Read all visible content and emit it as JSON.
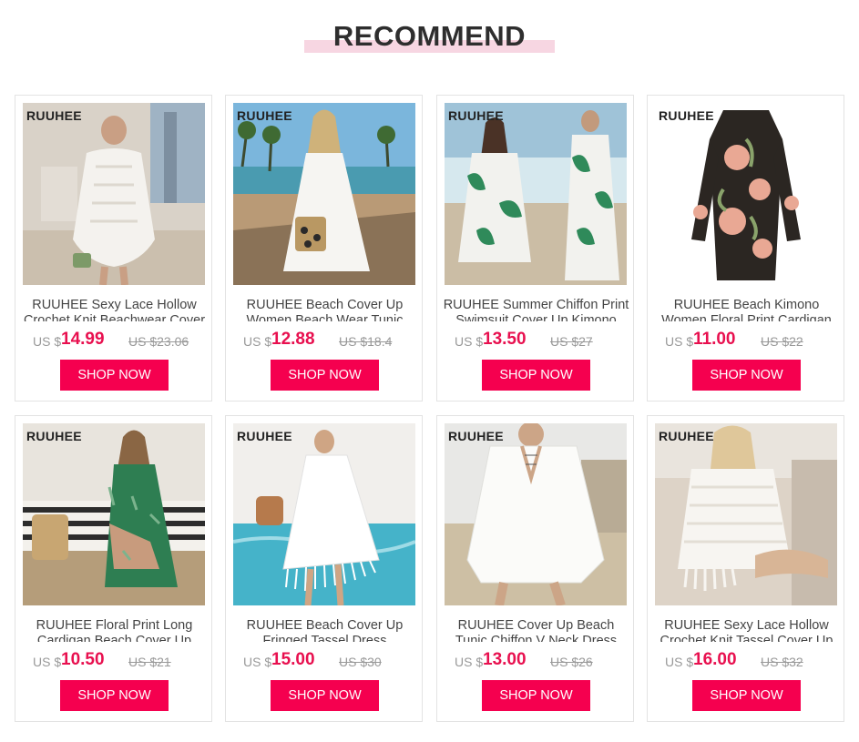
{
  "section": {
    "title": "RECOMMEND",
    "accent_color": "#f5004f",
    "title_underline_color": "#f7d6e2"
  },
  "products": [
    {
      "brand": "RUUHEE",
      "name": "RUUHEE Sexy Lace Hollow Crochet Knit Beachwear Cover Up",
      "currency": "US $",
      "price": "14.99",
      "old_price": "US $23.06",
      "button": "SHOP NOW"
    },
    {
      "brand": "RUUHEE",
      "name": "RUUHEE Beach Cover Up Women Beach Wear Tunic Dress",
      "currency": "US $",
      "price": "12.88",
      "old_price": "US $18.4",
      "button": "SHOP NOW"
    },
    {
      "brand": "RUUHEE",
      "name": "RUUHEE Summer Chiffon Print Swimsuit Cover Up Kimono",
      "currency": "US $",
      "price": "13.50",
      "old_price": "US $27",
      "button": "SHOP NOW"
    },
    {
      "brand": "RUUHEE",
      "name": "RUUHEE Beach Kimono Women Floral Print Cardigan",
      "currency": "US $",
      "price": "11.00",
      "old_price": "US $22",
      "button": "SHOP NOW"
    },
    {
      "brand": "RUUHEE",
      "name": "RUUHEE Floral Print Long Cardigan Beach Cover Up",
      "currency": "US $",
      "price": "10.50",
      "old_price": "US $21",
      "button": "SHOP NOW"
    },
    {
      "brand": "RUUHEE",
      "name": "RUUHEE Beach Cover Up Fringed Tassel Dress",
      "currency": "US $",
      "price": "15.00",
      "old_price": "US $30",
      "button": "SHOP NOW"
    },
    {
      "brand": "RUUHEE",
      "name": "RUUHEE Cover Up Beach Tunic Chiffon V Neck Dress",
      "currency": "US $",
      "price": "13.00",
      "old_price": "US $26",
      "button": "SHOP NOW"
    },
    {
      "brand": "RUUHEE",
      "name": "RUUHEE Sexy Lace Hollow Crochet Knit Tassel Cover Up",
      "currency": "US $",
      "price": "16.00",
      "old_price": "US $32",
      "button": "SHOP NOW"
    }
  ]
}
